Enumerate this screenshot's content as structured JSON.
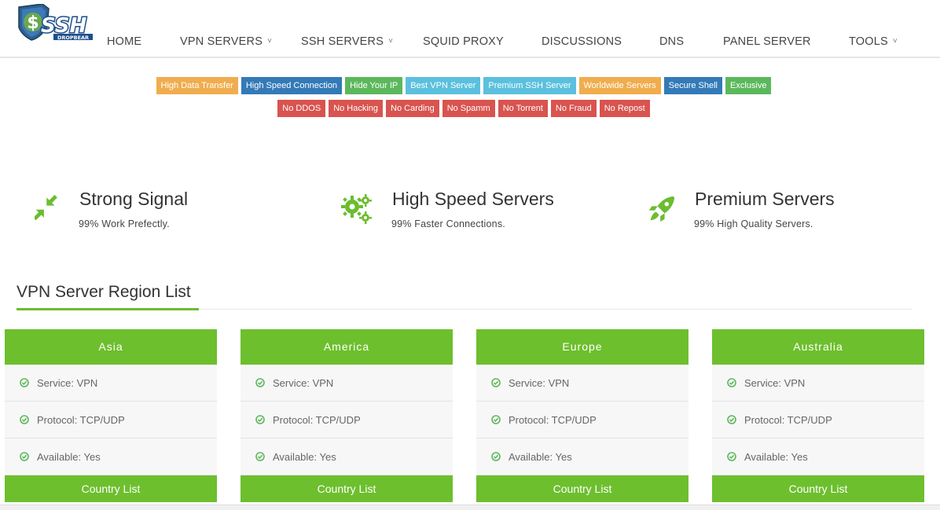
{
  "logo": {
    "text": "SSH",
    "subtext": "DROPBEAR"
  },
  "nav": {
    "items": [
      {
        "label": "HOME",
        "dropdown": false
      },
      {
        "label": "VPN SERVERS",
        "dropdown": true
      },
      {
        "label": "SSH SERVERS",
        "dropdown": true
      },
      {
        "label": "SQUID PROXY",
        "dropdown": false
      },
      {
        "label": "DISCUSSIONS",
        "dropdown": false
      },
      {
        "label": "DNS",
        "dropdown": false
      },
      {
        "label": "PANEL SERVER",
        "dropdown": false
      },
      {
        "label": "TOOLS",
        "dropdown": true
      }
    ],
    "caret": "˅"
  },
  "tags_row1": [
    {
      "label": "High Data Transfer",
      "color": "#f0ad4e"
    },
    {
      "label": "High Speed Connection",
      "color": "#337ab7"
    },
    {
      "label": "Hide Your IP",
      "color": "#5cb85c"
    },
    {
      "label": "Best VPN Server",
      "color": "#5bc0de"
    },
    {
      "label": "Premium SSH Server",
      "color": "#5bc0de"
    },
    {
      "label": "Worldwide Servers",
      "color": "#f0ad4e"
    },
    {
      "label": "Secure Shell",
      "color": "#337ab7"
    },
    {
      "label": "Exclusive",
      "color": "#5cb85c"
    }
  ],
  "tags_row2": [
    {
      "label": "No DDOS",
      "color": "#d9534f"
    },
    {
      "label": "No Hacking",
      "color": "#d9534f"
    },
    {
      "label": "No Carding",
      "color": "#d9534f"
    },
    {
      "label": "No Spamm",
      "color": "#d9534f"
    },
    {
      "label": "No Torrent",
      "color": "#d9534f"
    },
    {
      "label": "No Fraud",
      "color": "#d9534f"
    },
    {
      "label": "No Repost",
      "color": "#d9534f"
    }
  ],
  "features": [
    {
      "icon": "compress-arrows-icon",
      "title": "Strong Signal",
      "desc": "99% Work Prefectly."
    },
    {
      "icon": "gears-icon",
      "title": "High Speed Servers",
      "desc": "99% Faster Connections."
    },
    {
      "icon": "rocket-icon",
      "title": "Premium Servers",
      "desc": "99% High Quality Servers."
    }
  ],
  "section": {
    "title": "VPN Server Region List"
  },
  "regions": [
    {
      "name": "Asia",
      "service": "Service: VPN",
      "protocol": "Protocol: TCP/UDP",
      "available": "Available: Yes",
      "button": "Country List"
    },
    {
      "name": "America",
      "service": "Service: VPN",
      "protocol": "Protocol: TCP/UDP",
      "available": "Available: Yes",
      "button": "Country List"
    },
    {
      "name": "Europe",
      "service": "Service: VPN",
      "protocol": "Protocol: TCP/UDP",
      "available": "Available: Yes",
      "button": "Country List"
    },
    {
      "name": "Australia",
      "service": "Service: VPN",
      "protocol": "Protocol: TCP/UDP",
      "available": "Available: Yes",
      "button": "Country List"
    }
  ],
  "colors": {
    "accent": "#6dbf2e",
    "icon_green": "#6cbd2e",
    "check_green": "#5cb85c"
  }
}
